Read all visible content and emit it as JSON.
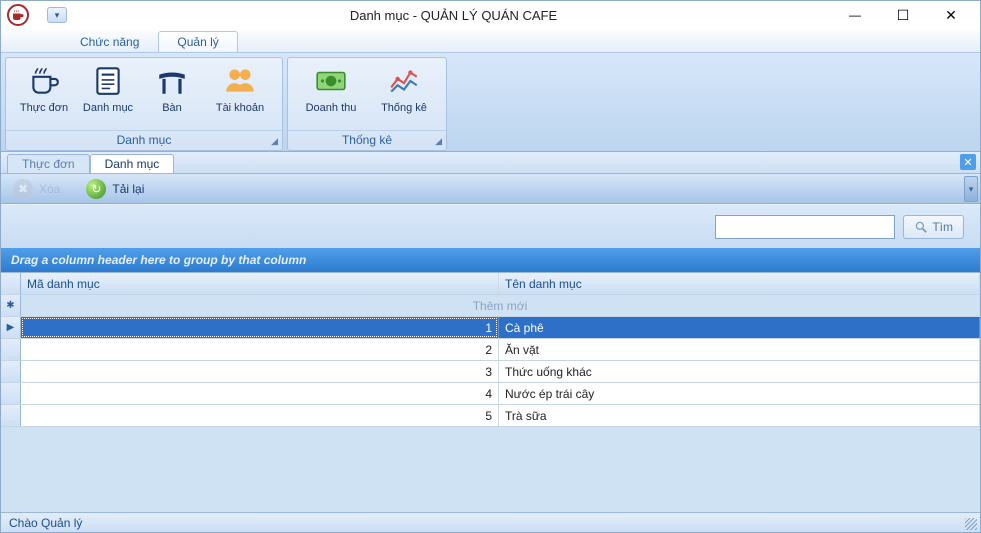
{
  "window": {
    "title": "Danh mục - QUẢN LÝ QUÁN CAFE"
  },
  "ribbon_tabs": {
    "tab1": "Chức năng",
    "tab2": "Quản lý"
  },
  "ribbon": {
    "group1_label": "Danh mục",
    "group2_label": "Thống kê",
    "btn_thucdon": "Thực đơn",
    "btn_danhmuc": "Danh mục",
    "btn_ban": "Bàn",
    "btn_taikhoan": "Tài khoản",
    "btn_doanhthu": "Doanh thu",
    "btn_thongke": "Thống kê"
  },
  "content_tabs": {
    "tab1": "Thực đơn",
    "tab2": "Danh mục"
  },
  "toolbar": {
    "delete": "Xóa",
    "reload": "Tải lại"
  },
  "search": {
    "placeholder": "",
    "button": "Tìm"
  },
  "grid": {
    "group_hint": "Drag a column header here to group by that column",
    "col_id": "Mã danh mục",
    "col_name": "Tên danh mục",
    "new_row": "Thêm mới",
    "rows": [
      {
        "id": "1",
        "name": "Cà phê"
      },
      {
        "id": "2",
        "name": "Ăn vặt"
      },
      {
        "id": "3",
        "name": "Thức uống khác"
      },
      {
        "id": "4",
        "name": "Nước ép trái cây"
      },
      {
        "id": "5",
        "name": "Trà sữa"
      }
    ]
  },
  "status": {
    "text": "Chào Quản lý"
  }
}
